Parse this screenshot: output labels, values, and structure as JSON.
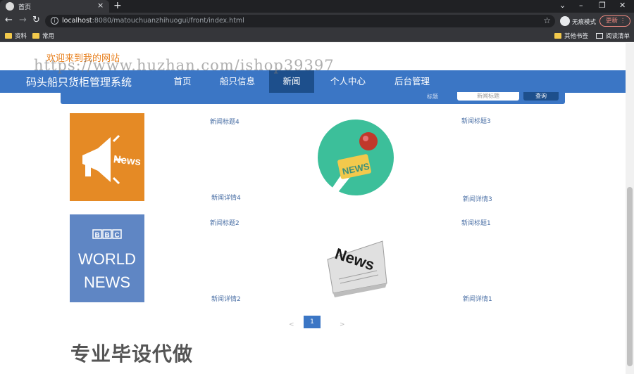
{
  "browser": {
    "tab_title": "首页",
    "tab_close": "×",
    "new_tab": "+",
    "url_host": "localhost",
    "url_rest": ":8080/matouchuanzhihuogui/front/index.html",
    "incognito_label": "无痕模式",
    "update_label": "更新",
    "bookmarks": [
      "资料",
      "常用"
    ],
    "other_bookmarks": "其他书签",
    "reading_list": "阅读清单"
  },
  "page": {
    "welcome": "欢迎来到我的网站",
    "watermark": "https://www.huzhan.com/ishop39397",
    "brand": "码头船只货柜管理系统",
    "nav": [
      "首页",
      "船只信息",
      "新闻",
      "个人中心",
      "后台管理"
    ],
    "active_nav": "新闻",
    "search_label": "标题",
    "search_placeholder": "新闻标题",
    "search_button": "查询",
    "news": [
      {
        "title": "新闻标题4",
        "detail": "新闻详情4",
        "image": "news-megaphone-icon"
      },
      {
        "title": "新闻标题3",
        "detail": "新闻详情3",
        "image": "news-microphone-icon"
      },
      {
        "title": "新闻标题2",
        "detail": "新闻详情2",
        "image": "bbc-world-news-logo"
      },
      {
        "title": "新闻标题1",
        "detail": "新闻详情1",
        "image": "news-newspaper-icon"
      }
    ],
    "pager": {
      "prev": "<",
      "current": "1",
      "next": ">"
    },
    "promo": "专业毕设代做"
  },
  "colors": {
    "nav_blue": "#3b76c5",
    "nav_active": "#1d4f8c",
    "welcome_orange": "#e8801e",
    "megaphone_bg": "#e58a25",
    "bbc_bg": "#5f86c4",
    "mic_circle": "#3cbf9a"
  }
}
